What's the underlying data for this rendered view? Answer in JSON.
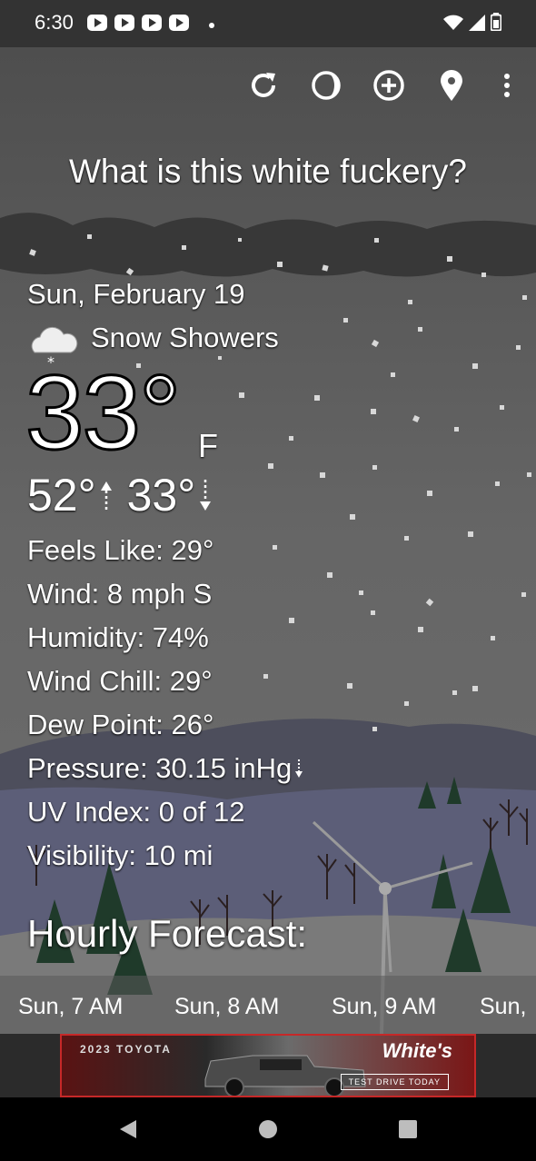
{
  "status_bar": {
    "time": "6:30"
  },
  "toolbar": {
    "icons": [
      "refresh-icon",
      "theme-icon",
      "add-location-icon",
      "location-pin-icon",
      "more-vert-icon"
    ]
  },
  "headline": "What is this white fuckery?",
  "current": {
    "date": "Sun, February 19",
    "condition": "Snow Showers",
    "condition_icon": "snow-cloud-icon",
    "temperature": "33°",
    "unit": "F",
    "high": "52°",
    "low": "33°"
  },
  "details": [
    "Feels Like:  29°",
    "Wind:  8 mph S",
    "Humidity:  74%",
    "Wind Chill:  29°",
    "Dew Point:  26°",
    "Pressure:  30.15 inHg",
    "UV Index:  0 of 12",
    "Visibility:  10 mi"
  ],
  "hourly": {
    "title": "Hourly Forecast:",
    "hours": [
      "Sun, 7 AM",
      "Sun, 8 AM",
      "Sun, 9 AM",
      "Sun,"
    ]
  },
  "ad": {
    "left_text": "2023 TOYOTA",
    "brand": "White's",
    "cta": "TEST DRIVE TODAY"
  },
  "colors": {
    "sky_top": "#505050",
    "sky_mid": "#666666",
    "ad_border": "#c62828"
  }
}
